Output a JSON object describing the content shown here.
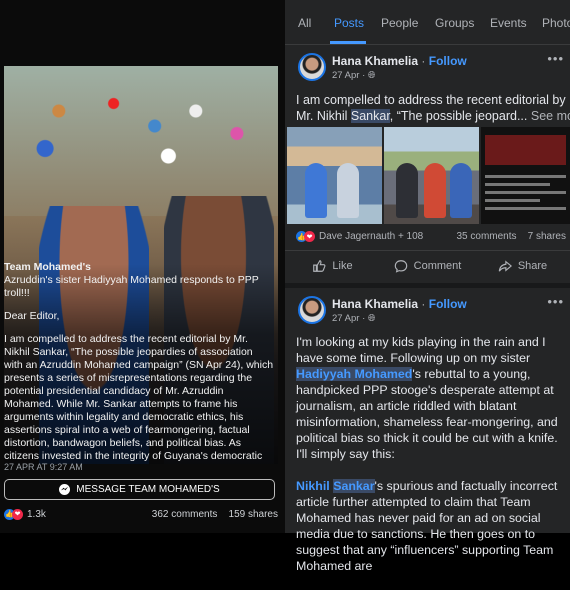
{
  "left_post": {
    "overlay": {
      "page_title": "Team Mohamed's",
      "headline": "Azruddin's sister Hadiyyah Mohamed responds to PPP troll!!!",
      "salutation": "Dear Editor,",
      "body": "I am compelled to address the recent editorial by Mr. Nikhil Sankar, “The possible jeopardies of association with an Azruddin Mohamed campaign” (SN Apr 24), which presents a series of misrepresentations regarding the potential presidential candidacy of Mr. Azruddin Mohamed. While Mr. Sankar attempts to frame his arguments within legality and democratic ethics, his assertions spiral into a web of fearmongering, factual distortion, bandwagon beliefs, and political bias. As citizens invested in the integrity of Guyana's democratic"
    },
    "timestamp": "27 APR AT 9:27 AM",
    "message_button": "MESSAGE TEAM MOHAMED'S",
    "reaction_count": "1.3k",
    "comments": "362 comments",
    "shares": "159 shares"
  },
  "tabs": [
    "All",
    "Posts",
    "People",
    "Groups",
    "Events",
    "Photo"
  ],
  "active_tab": "Posts",
  "post1": {
    "author": "Hana Khamelia",
    "separator": "·",
    "follow": "Follow",
    "date": "27 Apr",
    "text_before": "I am compelled to address the recent editorial by",
    "text_mid_before": "Mr. Nikhil ",
    "highlight": "Sankar",
    "text_mid_after": ", “The possible jeopard...",
    "see_more": "See more",
    "reactors": "Dave Jagernauth + 108",
    "comments": "35 comments",
    "shares": "7 shares",
    "actions": {
      "like": "Like",
      "comment": "Comment",
      "share": "Share"
    }
  },
  "post2": {
    "author": "Hana Khamelia",
    "separator": "·",
    "follow": "Follow",
    "date": "27 Apr",
    "para1_a": "I'm looking at my kids playing in the rain and I have some time. Following up on my sister ",
    "para1_link_hl": "Hadiyyah Mohamed",
    "para1_b": "'s rebuttal to a young, handpicked PPP stooge's desperate attempt at journalism, an article riddled with blatant misinformation, shameless fear-mongering, and political bias so thick it could be cut with a knife. I'll simply say this:",
    "para2_link_a": "Nikhil ",
    "para2_link_hl": "Sankar",
    "para2_b": "'s spurious and factually incorrect article further attempted to claim that Team Mohamed has never paid for an ad on social media due to sanctions. He then goes on to suggest that any “influencers” supporting Team Mohamed are"
  },
  "colors": {
    "accent": "#4599ff",
    "like": "#1b74e4",
    "love": "#f0284a",
    "background": "#18191a"
  }
}
